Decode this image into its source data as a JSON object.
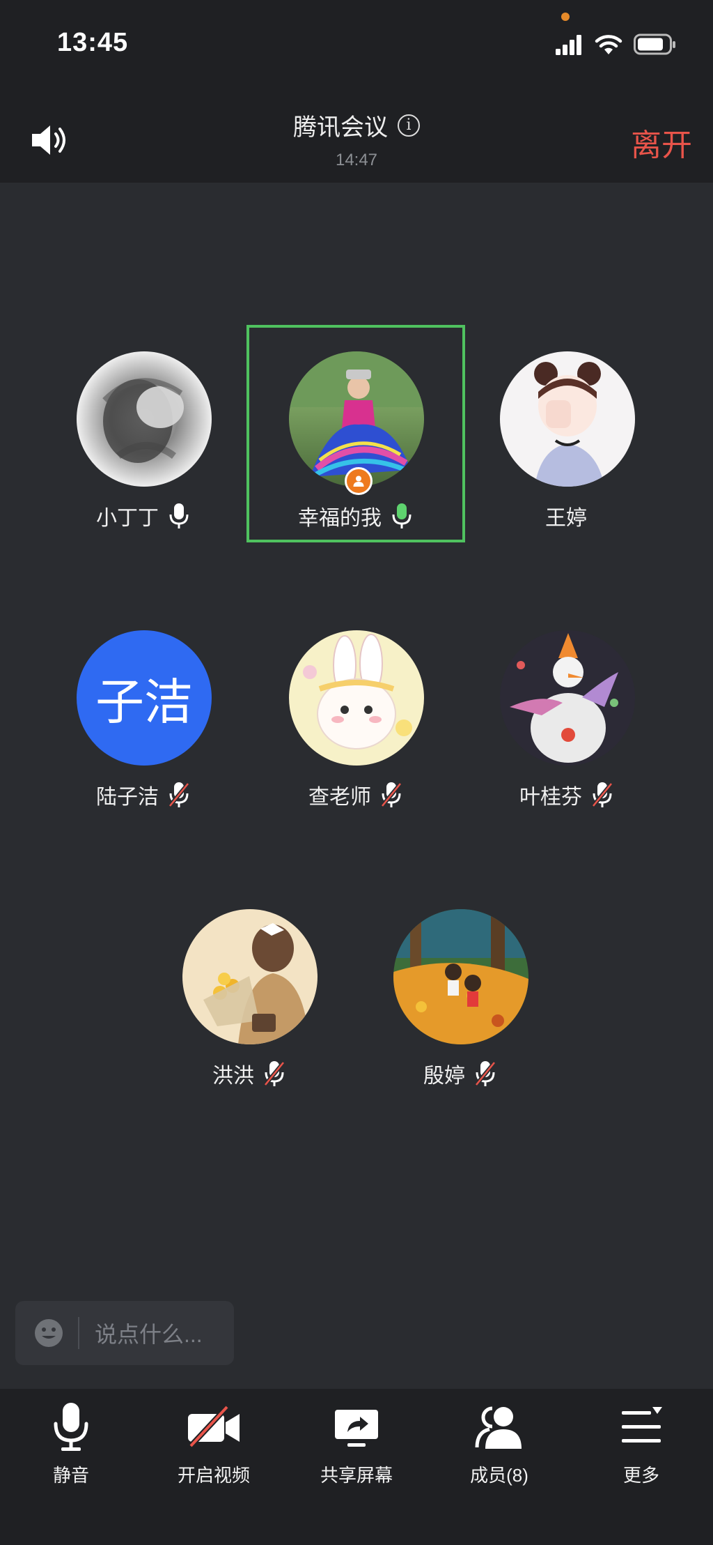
{
  "status": {
    "time": "13:45"
  },
  "header": {
    "title": "腾讯会议",
    "duration": "14:47",
    "leave": "离开"
  },
  "participants": [
    {
      "name": "小丁丁",
      "mic": "on"
    },
    {
      "name": "幸福的我",
      "mic": "speaking",
      "host": true
    },
    {
      "name": "王婷",
      "mic": "none"
    },
    {
      "name": "陆子洁",
      "mic": "muted",
      "initials": "子洁"
    },
    {
      "name": "查老师",
      "mic": "muted"
    },
    {
      "name": "叶桂芬",
      "mic": "muted"
    },
    {
      "name": "洪洪",
      "mic": "muted"
    },
    {
      "name": "殷婷",
      "mic": "muted"
    }
  ],
  "chat": {
    "placeholder": "说点什么..."
  },
  "toolbar": {
    "mute": "静音",
    "video": "开启视频",
    "share": "共享屏幕",
    "members": "成员(8)",
    "more": "更多"
  },
  "colors": {
    "leave": "#e8544a",
    "speaking": "#5ed36e",
    "active_frame": "#4fc25f",
    "host_badge": "#ee7a1e",
    "avatar_blue": "#2f6af2"
  }
}
